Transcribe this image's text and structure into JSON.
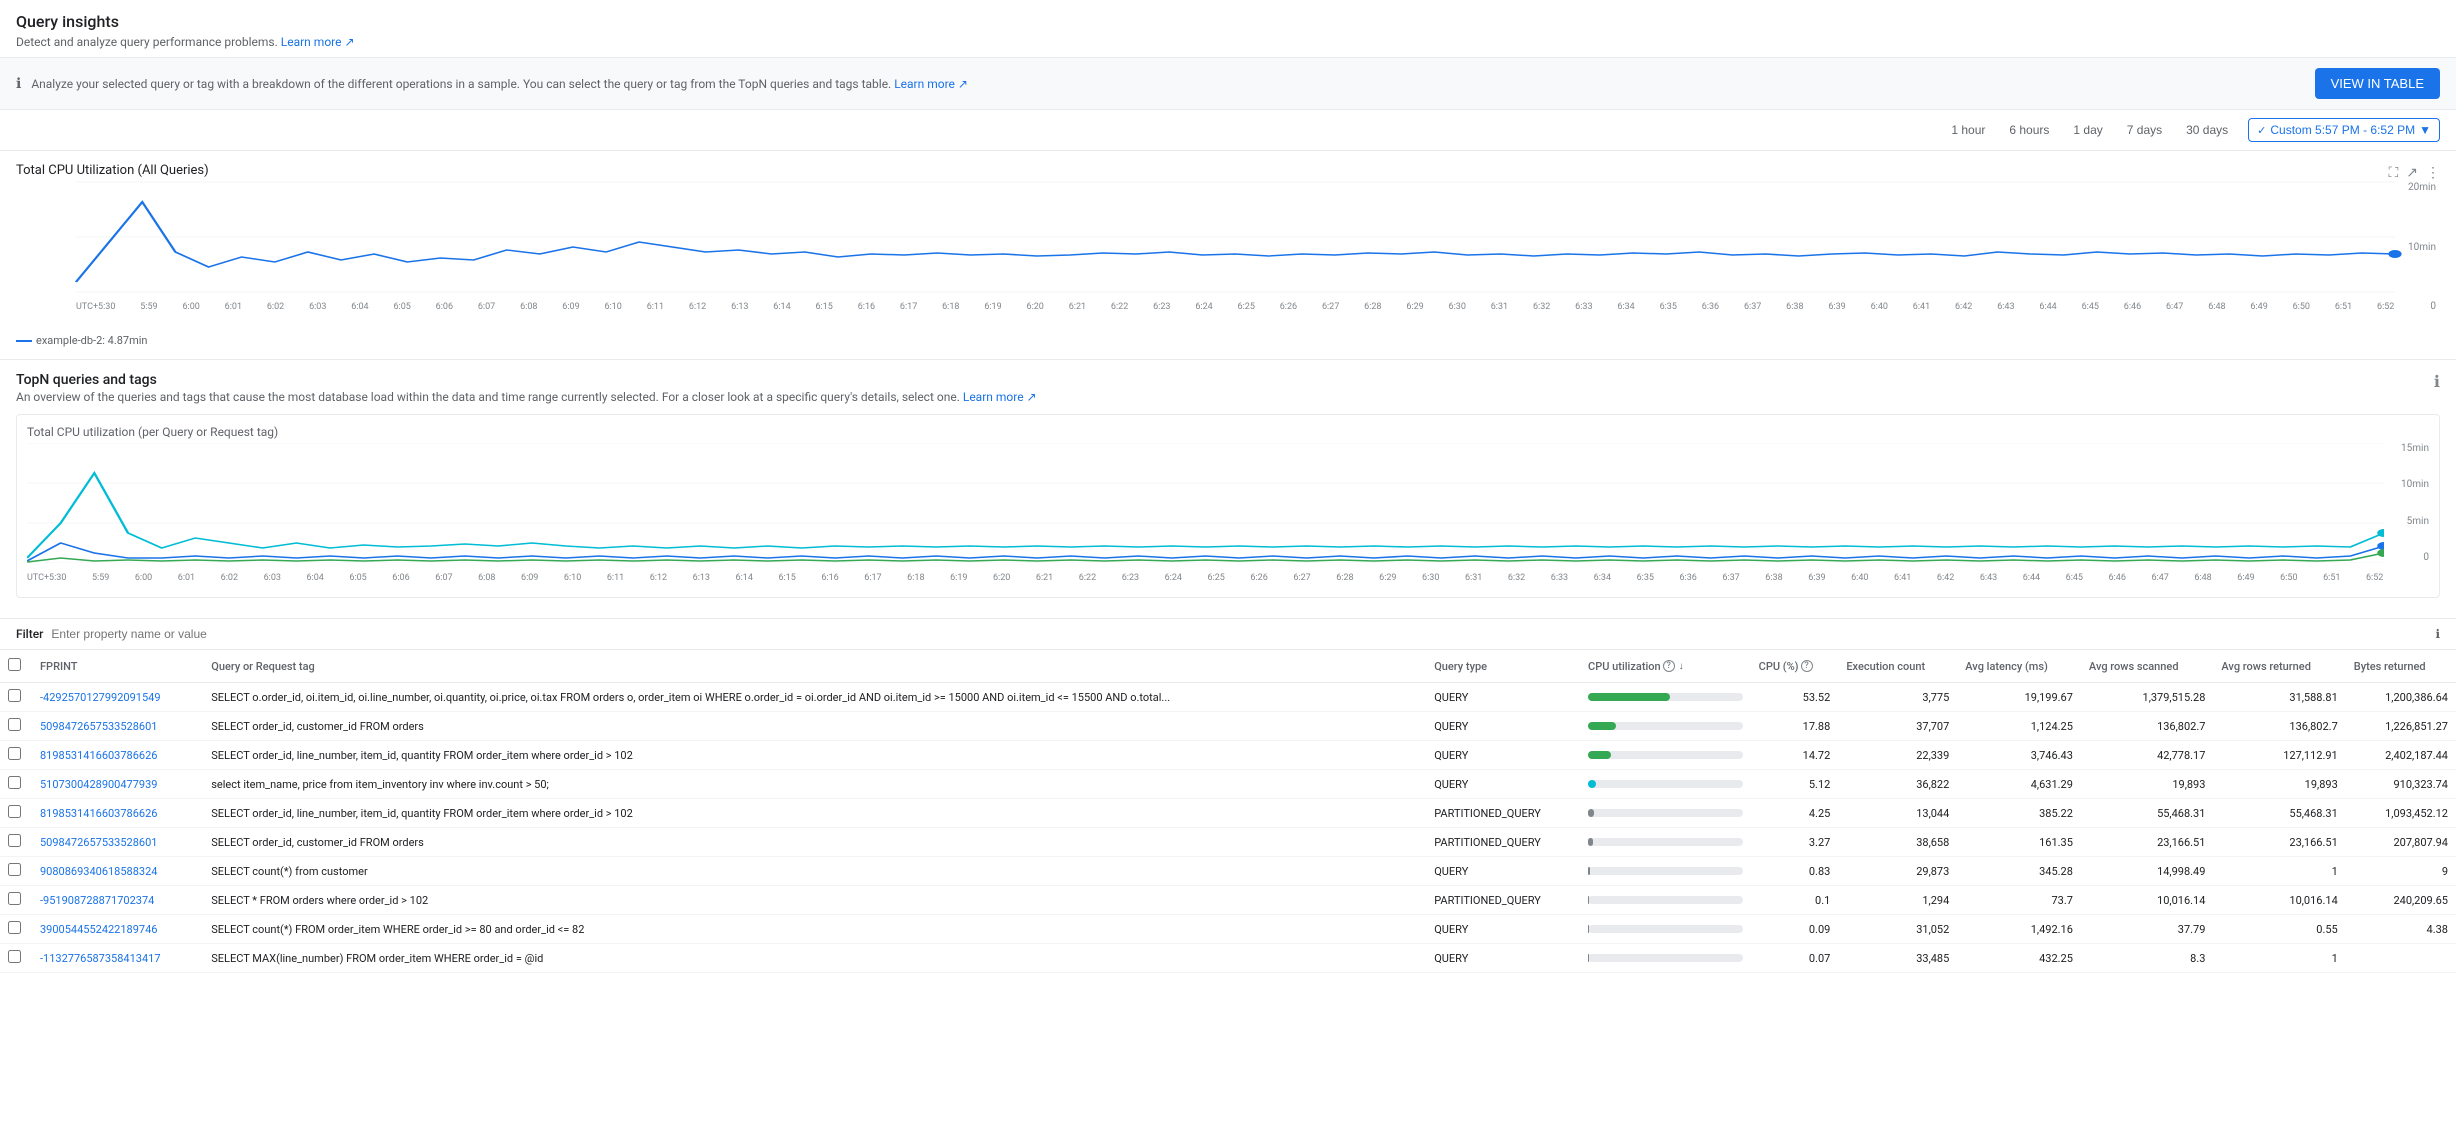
{
  "page": {
    "title": "Query insights",
    "subtitle": "Detect and analyze query performance problems.",
    "subtitle_link": "Learn more",
    "info_banner": {
      "text": "Analyze your selected query or tag with a breakdown of the different operations in a sample. You can select the query or tag from the TopN queries and tags table.",
      "link": "Learn more",
      "button_label": "VIEW IN TABLE"
    }
  },
  "time_range": {
    "options": [
      "1 hour",
      "6 hours",
      "1 day",
      "7 days",
      "30 days"
    ],
    "custom_label": "Custom 5:57 PM - 6:52 PM",
    "active": "custom"
  },
  "total_cpu_chart": {
    "title": "Total CPU Utilization (All Queries)",
    "y_labels": [
      "20min",
      "10min",
      "0"
    ],
    "legend": "example-db-2: 4.87min",
    "x_labels": [
      "UTC+5:30",
      "5:59 PM",
      "6:00 PM",
      "6:01 PM",
      "6:02 PM",
      "6:03 PM",
      "6:04 PM",
      "6:05 PM",
      "6:06 PM",
      "6:07 PM",
      "6:08 PM",
      "6:09 PM",
      "6:10 PM",
      "6:11 PM",
      "6:12 PM",
      "6:13 PM",
      "6:14 PM",
      "6:15 PM",
      "6:16 PM",
      "6:17 PM",
      "6:18 PM",
      "6:19 PM",
      "6:20 PM",
      "6:21 PM",
      "6:22 PM",
      "6:23 PM",
      "6:24 PM",
      "6:25 PM",
      "6:26 PM",
      "6:27 PM",
      "6:28 PM",
      "6:29 PM",
      "6:30 PM",
      "6:31 PM",
      "6:32 PM",
      "6:33 PM",
      "6:34 PM",
      "6:35 PM",
      "6:36 PM",
      "6:37 PM",
      "6:38 PM",
      "6:39 PM",
      "6:40 PM",
      "6:41 PM",
      "6:42 PM",
      "6:43 PM",
      "6:44 PM",
      "6:45 PM",
      "6:46 PM",
      "6:47 PM",
      "6:48 PM",
      "6:49 PM",
      "6:50 PM",
      "6:51 PM",
      "6:52 PM"
    ]
  },
  "topn_section": {
    "title": "TopN queries and tags",
    "subtitle": "An overview of the queries and tags that cause the most database load within the data and time range currently selected. For a closer look at a specific query's details, select one.",
    "subtitle_link": "Learn more",
    "cpu_chart_title": "Total CPU utilization (per Query or Request tag)",
    "y_labels": [
      "15min",
      "10min",
      "5min",
      "0"
    ]
  },
  "filter": {
    "label": "Filter",
    "placeholder": "Enter property name or value"
  },
  "table": {
    "columns": [
      {
        "key": "checkbox",
        "label": ""
      },
      {
        "key": "fprint",
        "label": "FPRINT"
      },
      {
        "key": "query_tag",
        "label": "Query or Request tag"
      },
      {
        "key": "query_type",
        "label": "Query type"
      },
      {
        "key": "cpu_util",
        "label": "CPU utilization"
      },
      {
        "key": "cpu_pct",
        "label": "CPU (%)"
      },
      {
        "key": "exec_count",
        "label": "Execution count"
      },
      {
        "key": "avg_latency",
        "label": "Avg latency (ms)"
      },
      {
        "key": "avg_rows_scanned",
        "label": "Avg rows scanned"
      },
      {
        "key": "avg_rows_returned",
        "label": "Avg rows returned"
      },
      {
        "key": "bytes_returned",
        "label": "Bytes returned"
      }
    ],
    "rows": [
      {
        "fprint": "-4292570127992091549",
        "query": "SELECT o.order_id, oi.item_id, oi.line_number, oi.quantity, oi.price, oi.tax FROM orders o, order_item oi WHERE o.order_id = oi.order_id AND oi.item_id >= 15000 AND oi.item_id <= 15500 AND o.total...",
        "query_type": "QUERY",
        "cpu_bar_pct": 53,
        "cpu_bar_color": "green",
        "cpu_pct": "53.52",
        "exec_count": "3,775",
        "avg_latency": "19,199.67",
        "avg_rows_scanned": "1,379,515.28",
        "avg_rows_returned": "31,588.81",
        "bytes_returned": "1,200,386.64"
      },
      {
        "fprint": "5098472657533528601",
        "query": "SELECT order_id, customer_id FROM orders",
        "query_type": "QUERY",
        "cpu_bar_pct": 18,
        "cpu_bar_color": "green",
        "cpu_pct": "17.88",
        "exec_count": "37,707",
        "avg_latency": "1,124.25",
        "avg_rows_scanned": "136,802.7",
        "avg_rows_returned": "136,802.7",
        "bytes_returned": "1,226,851.27"
      },
      {
        "fprint": "8198531416603786626",
        "query": "SELECT order_id, line_number, item_id, quantity FROM order_item where order_id > 102",
        "query_type": "QUERY",
        "cpu_bar_pct": 15,
        "cpu_bar_color": "green",
        "cpu_pct": "14.72",
        "exec_count": "22,339",
        "avg_latency": "3,746.43",
        "avg_rows_scanned": "42,778.17",
        "avg_rows_returned": "127,112.91",
        "bytes_returned": "2,402,187.44"
      },
      {
        "fprint": "5107300428900477939",
        "query": "select item_name, price from item_inventory inv where inv.count > 50;",
        "query_type": "QUERY",
        "cpu_bar_pct": 5,
        "cpu_bar_color": "teal",
        "cpu_pct": "5.12",
        "exec_count": "36,822",
        "avg_latency": "4,631.29",
        "avg_rows_scanned": "19,893",
        "avg_rows_returned": "19,893",
        "bytes_returned": "910,323.74"
      },
      {
        "fprint": "8198531416603786626",
        "query": "SELECT order_id, line_number, item_id, quantity FROM order_item where order_id > 102",
        "query_type": "PARTITIONED_QUERY",
        "cpu_bar_pct": 4,
        "cpu_bar_color": "lightgray",
        "cpu_pct": "4.25",
        "exec_count": "13,044",
        "avg_latency": "385.22",
        "avg_rows_scanned": "55,468.31",
        "avg_rows_returned": "55,468.31",
        "bytes_returned": "1,093,452.12"
      },
      {
        "fprint": "5098472657533528601",
        "query": "SELECT order_id, customer_id FROM orders",
        "query_type": "PARTITIONED_QUERY",
        "cpu_bar_pct": 3,
        "cpu_bar_color": "lightgray",
        "cpu_pct": "3.27",
        "exec_count": "38,658",
        "avg_latency": "161.35",
        "avg_rows_scanned": "23,166.51",
        "avg_rows_returned": "23,166.51",
        "bytes_returned": "207,807.94"
      },
      {
        "fprint": "9080869340618588324",
        "query": "SELECT count(*) from customer",
        "query_type": "QUERY",
        "cpu_bar_pct": 1,
        "cpu_bar_color": "lightgray",
        "cpu_pct": "0.83",
        "exec_count": "29,873",
        "avg_latency": "345.28",
        "avg_rows_scanned": "14,998.49",
        "avg_rows_returned": "1",
        "bytes_returned": "9"
      },
      {
        "fprint": "-951908728871702374",
        "query": "SELECT * FROM orders where order_id > 102",
        "query_type": "PARTITIONED_QUERY",
        "cpu_bar_pct": 0.1,
        "cpu_bar_color": "lightgray",
        "cpu_pct": "0.1",
        "exec_count": "1,294",
        "avg_latency": "73.7",
        "avg_rows_scanned": "10,016.14",
        "avg_rows_returned": "10,016.14",
        "bytes_returned": "240,209.65"
      },
      {
        "fprint": "3900544552422189746",
        "query": "SELECT count(*) FROM order_item WHERE order_id >= 80 and order_id <= 82",
        "query_type": "QUERY",
        "cpu_bar_pct": 0.09,
        "cpu_bar_color": "lightgray",
        "cpu_pct": "0.09",
        "exec_count": "31,052",
        "avg_latency": "1,492.16",
        "avg_rows_scanned": "37.79",
        "avg_rows_returned": "0.55",
        "bytes_returned": "4.38"
      },
      {
        "fprint": "-1132776587358413417",
        "query": "SELECT MAX(line_number) FROM order_item WHERE order_id = @id",
        "query_type": "QUERY",
        "cpu_bar_pct": 0.07,
        "cpu_bar_color": "lightgray",
        "cpu_pct": "0.07",
        "exec_count": "33,485",
        "avg_latency": "432.25",
        "avg_rows_scanned": "8.3",
        "avg_rows_returned": "1",
        "bytes_returned": ""
      }
    ]
  }
}
